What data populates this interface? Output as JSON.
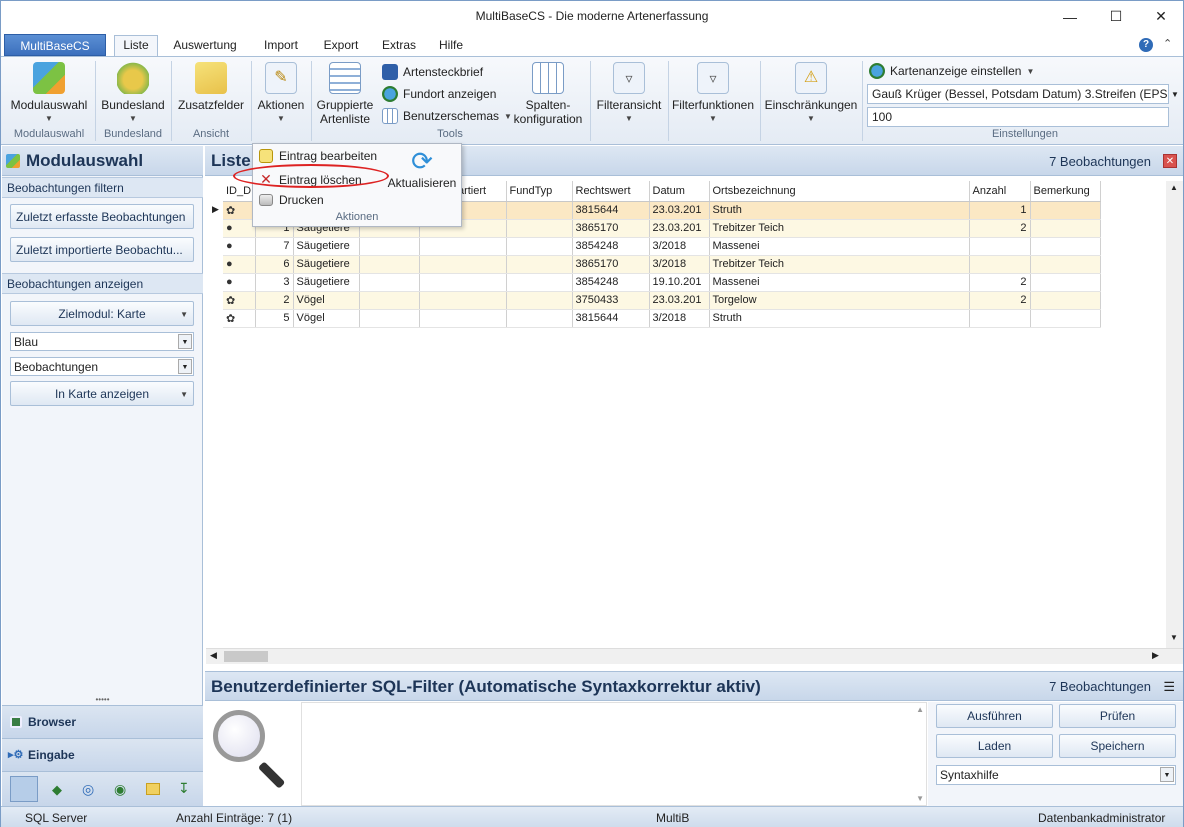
{
  "window": {
    "title": "MultiBaseCS - Die moderne Artenerfassung"
  },
  "tabs": {
    "app": "MultiBaseCS",
    "items": [
      "Liste",
      "Auswertung",
      "Import",
      "Export",
      "Extras",
      "Hilfe"
    ]
  },
  "ribbon": {
    "modulauswahl": "Modulauswahl",
    "bundesland": "Bundesland",
    "zusatzfelder": "Zusatzfelder",
    "aktionen": "Aktionen",
    "gruppierte1": "Gruppierte",
    "gruppierte2": "Artenliste",
    "artensteckbrief": "Artensteckbrief",
    "fundort": "Fundort anzeigen",
    "benutzerschemas": "Benutzerschemas",
    "spalten1": "Spalten-",
    "spalten2": "konfiguration",
    "filteransicht": "Filteransicht",
    "filterfunktionen": "Filterfunktionen",
    "einschraenkungen": "Einschränkungen",
    "karte": "Kartenanzeige einstellen",
    "projection": "Gauß Krüger (Bessel, Potsdam Datum) 3.Streifen (EPSG: 3",
    "value": "100",
    "groups": {
      "modulauswahl": "Modulauswahl",
      "bundesland": "Bundesland",
      "ansicht": "Ansicht",
      "tools": "Tools",
      "einstellungen": "Einstellungen"
    }
  },
  "menu": {
    "bearbeiten": "Eintrag  bearbeiten",
    "loeschen": "Eintrag  löschen",
    "drucken": "Drucken",
    "aktualisieren": "Aktualisieren",
    "group": "Aktionen"
  },
  "left": {
    "title": "Modulauswahl",
    "filter_section": "Beobachtungen filtern",
    "btn_recent": "Zuletzt erfasste Beobachtungen",
    "btn_imported": "Zuletzt  importierte Beobachtu...",
    "show_section": "Beobachtungen anzeigen",
    "ziel": "Zielmodul: Karte",
    "combo1": "Blau",
    "combo2": "Beobachtungen",
    "inkarte": "In Karte anzeigen",
    "nav_browser": "Browser",
    "nav_eingabe": "Eingabe"
  },
  "list": {
    "title": "Liste",
    "count": "7 Beobachtungen",
    "columns": [
      "ID_D",
      "",
      "",
      "t",
      "Nicht Kartiert",
      "FundTyp",
      "Rechtswert",
      "Datum",
      "Ortsbezeichnung",
      "Anzahl",
      "Bemerkung"
    ],
    "rows": [
      {
        "icon": "bird",
        "id": "",
        "group": "",
        "rw": "3815644",
        "datum": "23.03.201",
        "ort": "Struth",
        "anzahl": "1"
      },
      {
        "icon": "paw",
        "id": "1",
        "group": "Säugetiere",
        "rw": "3865170",
        "datum": "23.03.201",
        "ort": "Trebitzer Teich",
        "anzahl": "2"
      },
      {
        "icon": "paw",
        "id": "7",
        "group": "Säugetiere",
        "rw": "3854248",
        "datum": "3/2018",
        "ort": "Massenei",
        "anzahl": ""
      },
      {
        "icon": "paw",
        "id": "6",
        "group": "Säugetiere",
        "rw": "3865170",
        "datum": "3/2018",
        "ort": "Trebitzer Teich",
        "anzahl": ""
      },
      {
        "icon": "paw",
        "id": "3",
        "group": "Säugetiere",
        "rw": "3854248",
        "datum": "19.10.201",
        "ort": "Massenei",
        "anzahl": "2"
      },
      {
        "icon": "bird",
        "id": "2",
        "group": "Vögel",
        "rw": "3750433",
        "datum": "23.03.201",
        "ort": "Torgelow",
        "anzahl": "2"
      },
      {
        "icon": "bird",
        "id": "5",
        "group": "Vögel",
        "rw": "3815644",
        "datum": "3/2018",
        "ort": "Struth",
        "anzahl": ""
      }
    ]
  },
  "sql": {
    "title": "Benutzerdefinierter SQL-Filter (Automatische Syntaxkorrektur aktiv)",
    "count": "7 Beobachtungen",
    "ausfuehren": "Ausführen",
    "pruefen": "Prüfen",
    "laden": "Laden",
    "speichern": "Speichern",
    "syntax": "Syntaxhilfe"
  },
  "status": {
    "server": "SQL Server",
    "entries": "Anzahl Einträge: 7 (1)",
    "db": "MultiB",
    "user": "Datenbankadministrator"
  }
}
